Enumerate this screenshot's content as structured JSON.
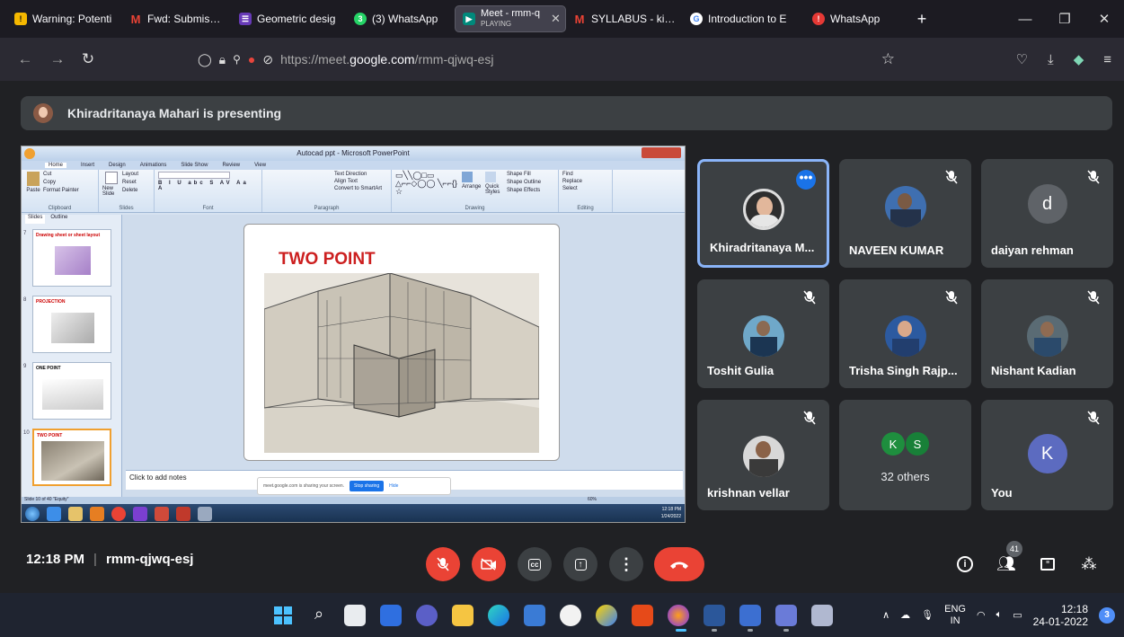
{
  "browser": {
    "tabs": [
      {
        "label": "Warning: Potenti",
        "icon": "warning-icon",
        "color": "#f5b800"
      },
      {
        "label": "Fwd: Submission",
        "icon": "gmail-icon",
        "color": "#ea4335"
      },
      {
        "label": "Geometric desig",
        "icon": "forms-icon",
        "color": "#673ab7"
      },
      {
        "label": "(3) WhatsApp",
        "icon": "whatsapp-icon",
        "color": "#25d366"
      },
      {
        "label": "Meet - rmm-q",
        "sub": "PLAYING",
        "icon": "meet-icon",
        "color": "#00897b",
        "active": true
      },
      {
        "label": "SYLLABUS - kiran",
        "icon": "gmail-icon",
        "color": "#ea4335"
      },
      {
        "label": "Introduction to E",
        "icon": "google-icon",
        "color": "#4285f4"
      },
      {
        "label": "WhatsApp",
        "icon": "whatsapp-red-icon",
        "color": "#e53935"
      }
    ],
    "new_tab": "+",
    "url": {
      "prefix": "https://meet.",
      "host": "google.com",
      "path": "/rmm-qjwq-esj"
    }
  },
  "meet": {
    "presenting_banner": "Khiradritanaya Mahari is presenting",
    "presentation": {
      "window_title": "Autocad ppt - Microsoft PowerPoint",
      "ribbon_tabs": [
        "Home",
        "Insert",
        "Design",
        "Animations",
        "Slide Show",
        "Review",
        "View"
      ],
      "ribbon_groups": [
        "Clipboard",
        "Slides",
        "Font",
        "Paragraph",
        "Drawing",
        "Editing"
      ],
      "clipboard_items": [
        "Cut",
        "Copy",
        "Format Painter"
      ],
      "slides_items": [
        "Layout",
        "Reset",
        "Delete"
      ],
      "paste_label": "Paste",
      "new_slide_label": "New Slide",
      "para_items": [
        "Text Direction",
        "Align Text",
        "Convert to SmartArt"
      ],
      "drawing_items": [
        "Shape Fill",
        "Shape Outline",
        "Shape Effects"
      ],
      "arrange_label": "Arrange",
      "quick_styles_label": "Quick Styles",
      "editing_items": [
        "Find",
        "Replace",
        "Select"
      ],
      "pane_tabs": [
        "Slides",
        "Outline"
      ],
      "thumbnails": [
        {
          "num": "7",
          "title": "Drawing sheet or sheet layout"
        },
        {
          "num": "8",
          "title": "PROJECTION"
        },
        {
          "num": "9",
          "title": "ONE POINT"
        },
        {
          "num": "10",
          "title": "TWO POINT"
        }
      ],
      "slide_title": "TWO POINT",
      "notes_placeholder": "Click to add notes",
      "share_text": "meet.google.com is sharing your screen.",
      "stop_sharing": "Stop sharing",
      "hide": "Hide",
      "status": "Slide 10 of 40   \"Equity\"",
      "zoom": "60%",
      "tray_time": "12:18 PM",
      "tray_date": "1/24/2022"
    },
    "participants": [
      {
        "name": "Khiradritanaya M...",
        "speaking": true
      },
      {
        "name": "NAVEEN KUMAR",
        "muted": true
      },
      {
        "name": "daiyan rehman",
        "letter": "d",
        "color": "#5f6368",
        "muted": true
      },
      {
        "name": "Toshit Gulia",
        "muted": true
      },
      {
        "name": "Trisha Singh Rajp...",
        "muted": true
      },
      {
        "name": "Nishant Kadian",
        "muted": true
      },
      {
        "name": "krishnan vellar",
        "muted": true
      },
      {
        "name": "You",
        "letter": "K",
        "color": "#5c6bc0",
        "muted": true
      }
    ],
    "others": {
      "letters": [
        "K",
        "S"
      ],
      "colors": [
        "#1e8e3e",
        "#188038"
      ],
      "label": "32 others"
    },
    "bottom": {
      "time": "12:18 PM",
      "separator": "|",
      "code": "rmm-qjwq-esj",
      "people_count": "41"
    }
  },
  "taskbar": {
    "lang1": "ENG",
    "lang2": "IN",
    "time": "12:18",
    "date": "24-01-2022",
    "notifications": "3"
  }
}
